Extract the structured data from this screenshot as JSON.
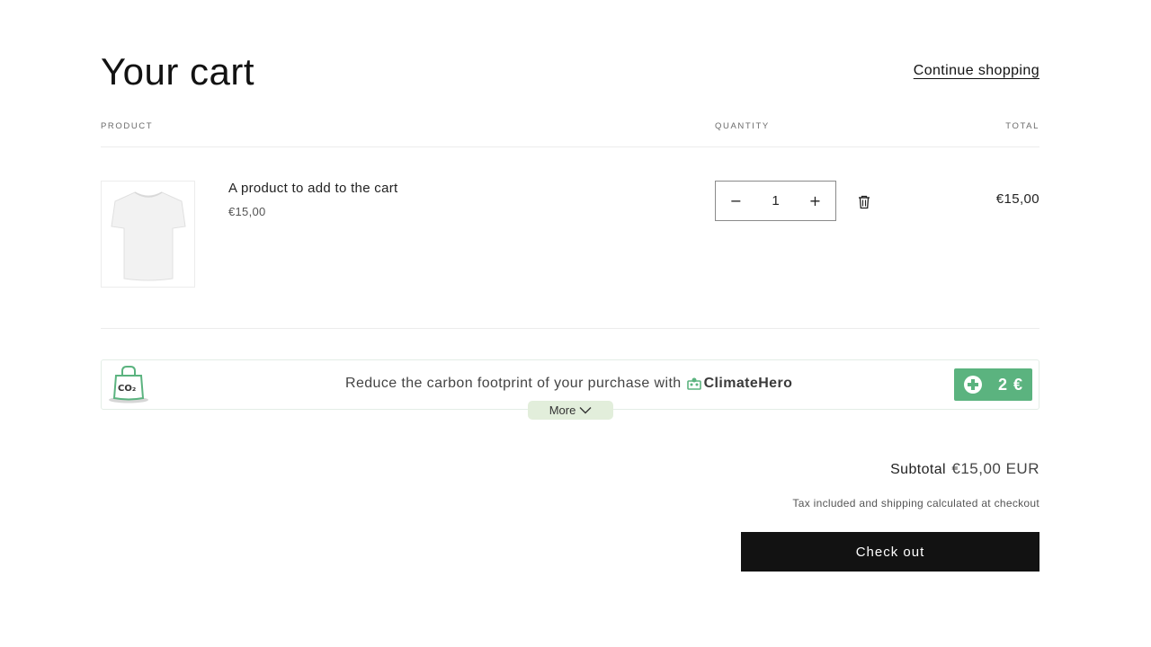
{
  "header": {
    "title": "Your cart",
    "continue_link": "Continue shopping"
  },
  "columns": {
    "product": "PRODUCT",
    "quantity": "QUANTITY",
    "total": "TOTAL"
  },
  "items": [
    {
      "name": "A product to add to the cart",
      "price": "€15,00",
      "quantity": "1",
      "line_total": "€15,00",
      "image": "white-tshirt"
    }
  ],
  "quantity_controls": {
    "decrease": "−",
    "increase": "+"
  },
  "climatehero": {
    "text": "Reduce the carbon footprint of your purchase with",
    "brand": "ClimateHero",
    "logo_text": "CO₂",
    "add_amount": "2 €",
    "more_label": "More",
    "accent_color": "#5bb37f",
    "more_bg_color": "#e2eedb"
  },
  "summary": {
    "subtotal_label": "Subtotal",
    "subtotal_value": "€15,00 EUR",
    "tax_note": "Tax included and shipping calculated at checkout",
    "checkout_label": "Check out"
  }
}
